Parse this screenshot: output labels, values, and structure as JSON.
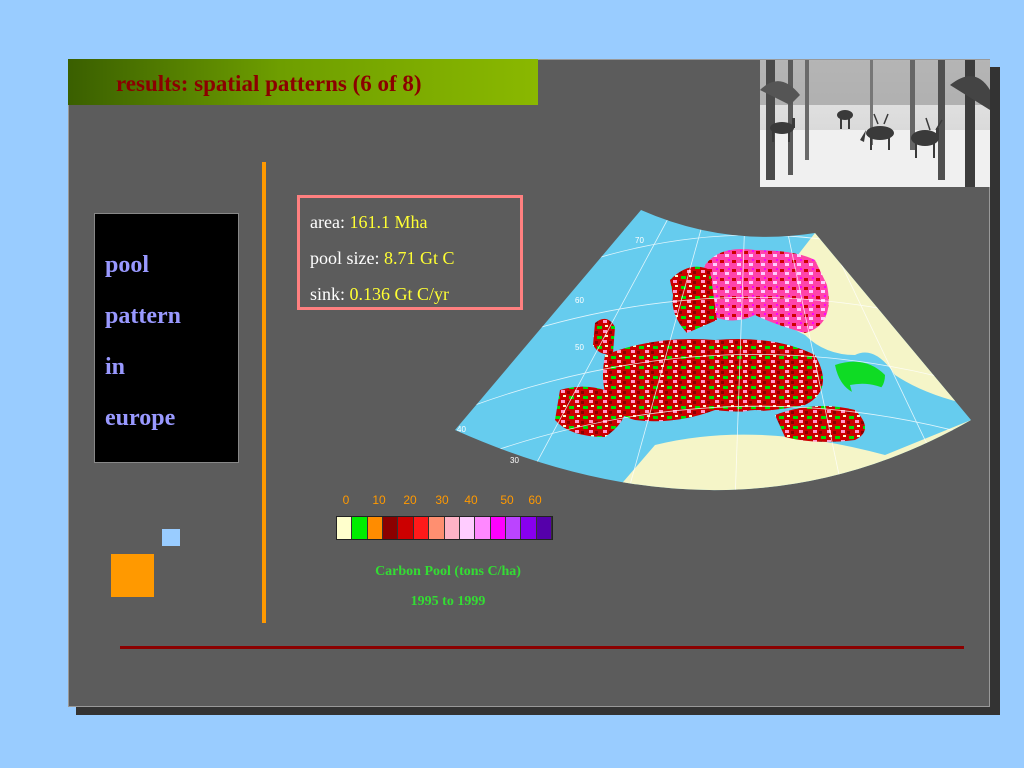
{
  "slide": {
    "title": "results: spatial patterns (6 of 8)",
    "topic_lines": [
      "pool",
      "pattern",
      "in",
      "europe"
    ]
  },
  "stats": [
    {
      "label": "area: ",
      "value": "161.1 Mha"
    },
    {
      "label": "pool size: ",
      "value": "8.71 Gt C"
    },
    {
      "label": "sink: ",
      "value": "0.136 Gt C/yr"
    }
  ],
  "legend": {
    "tick_labels": [
      "0",
      "10",
      "20",
      "30",
      "40",
      "50",
      "60"
    ],
    "swatch_colors": [
      "#ffffcc",
      "#00ee00",
      "#ff8c00",
      "#8b0000",
      "#cc0000",
      "#ff1a1a",
      "#ff8f70",
      "#ffb3c6",
      "#ffccff",
      "#ff88ff",
      "#ff00ff",
      "#bb44ff",
      "#8800ee",
      "#5500aa"
    ],
    "caption": "Carbon Pool (tons C/ha)",
    "period": "1995 to 1999"
  },
  "map": {
    "sea_color": "#66ccee",
    "land_color": "#f5f5c8",
    "latitude_labels": [
      "70",
      "60",
      "50",
      "40",
      "30"
    ]
  },
  "colors": {
    "background": "#99ccff",
    "slide": "#5c5c5c",
    "title": "#8b0000",
    "accent_orange": "#ff9900",
    "stat_value": "#ffff33",
    "topic_text": "#9999ff"
  },
  "photo": {
    "subject": "reindeer-in-snowy-forest"
  }
}
